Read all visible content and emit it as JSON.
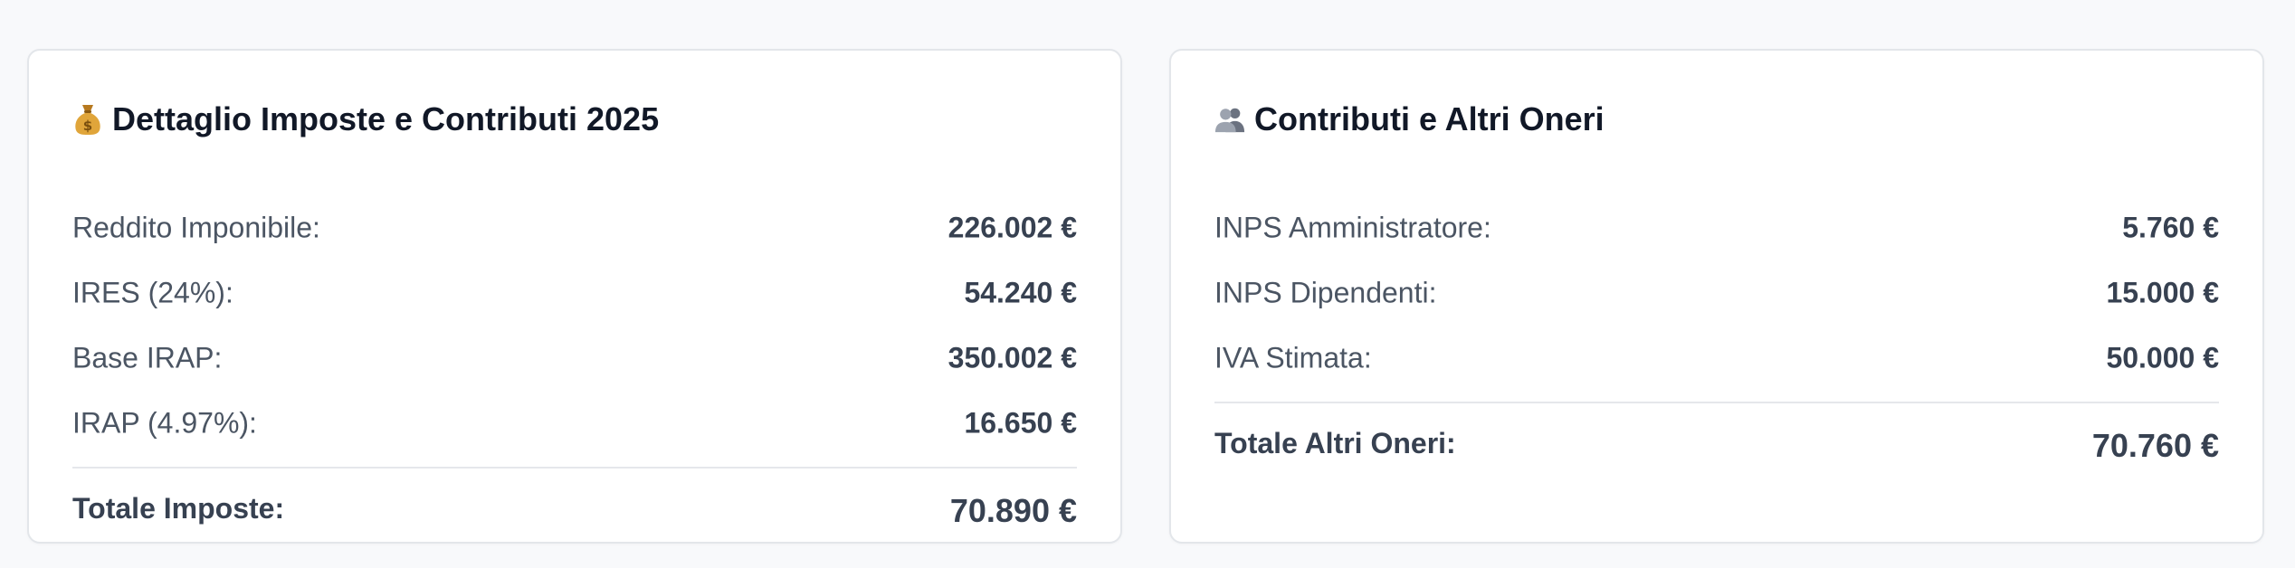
{
  "tax_card": {
    "icon": "money-bag-icon",
    "title": "Dettaglio Imposte e Contributi 2025",
    "rows": [
      {
        "label": "Reddito Imponibile:",
        "value": "226.002 €"
      },
      {
        "label": "IRES (24%):",
        "value": "54.240 €"
      },
      {
        "label": "Base IRAP:",
        "value": "350.002 €"
      },
      {
        "label": "IRAP (4.97%):",
        "value": "16.650 €"
      }
    ],
    "total": {
      "label": "Totale Imposte:",
      "value": "70.890 €"
    }
  },
  "other_card": {
    "icon": "people-icon",
    "title": "Contributi e Altri Oneri",
    "rows": [
      {
        "label": "INPS Amministratore:",
        "value": "5.760 €"
      },
      {
        "label": "INPS Dipendenti:",
        "value": "15.000 €"
      },
      {
        "label": "IVA Stimata:",
        "value": "50.000 €"
      }
    ],
    "total": {
      "label": "Totale Altri Oneri:",
      "value": "70.760 €"
    }
  }
}
